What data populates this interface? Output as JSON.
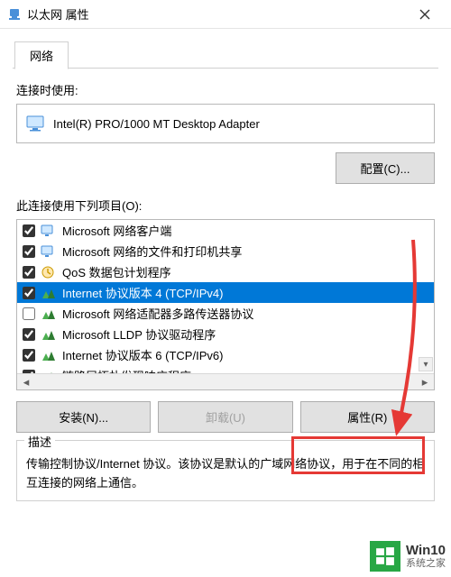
{
  "window": {
    "title": "以太网 属性"
  },
  "tabs": {
    "network": "网络"
  },
  "labels": {
    "connect_using": "连接时使用:",
    "items_list": "此连接使用下列项目(O):",
    "description_legend": "描述"
  },
  "adapter": {
    "name": "Intel(R) PRO/1000 MT Desktop Adapter"
  },
  "buttons": {
    "configure": "配置(C)...",
    "install": "安装(N)...",
    "uninstall": "卸载(U)",
    "properties": "属性(R)"
  },
  "list": {
    "items": [
      {
        "checked": true,
        "icon": "client",
        "label": "Microsoft 网络客户端",
        "selected": false
      },
      {
        "checked": true,
        "icon": "service",
        "label": "Microsoft 网络的文件和打印机共享",
        "selected": false
      },
      {
        "checked": true,
        "icon": "qos",
        "label": "QoS 数据包计划程序",
        "selected": false
      },
      {
        "checked": true,
        "icon": "protocol",
        "label": "Internet 协议版本 4 (TCP/IPv4)",
        "selected": true
      },
      {
        "checked": false,
        "icon": "protocol",
        "label": "Microsoft 网络适配器多路传送器协议",
        "selected": false
      },
      {
        "checked": true,
        "icon": "protocol",
        "label": "Microsoft LLDP 协议驱动程序",
        "selected": false
      },
      {
        "checked": true,
        "icon": "protocol",
        "label": "Internet 协议版本 6 (TCP/IPv6)",
        "selected": false
      },
      {
        "checked": true,
        "icon": "protocol",
        "label": "链路层拓扑发现响应程序",
        "selected": false
      }
    ]
  },
  "description": {
    "text": "传输控制协议/Internet 协议。该协议是默认的广域网络协议，用于在不同的相互连接的网络上通信。"
  },
  "watermark": {
    "line1": "Win10",
    "line2": "系统之家"
  },
  "annotation": {
    "arrow_color": "#e53935"
  }
}
